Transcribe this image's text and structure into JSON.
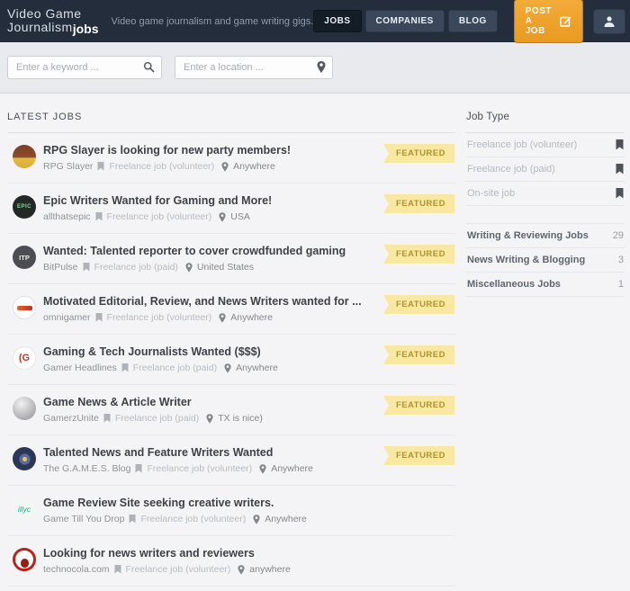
{
  "header": {
    "logo_line1": "Video Game",
    "logo_line2": "Journalism",
    "logo_suffix": "jobs",
    "tagline": "Video game journalism and game writing gigs.",
    "nav": {
      "jobs": "JOBS",
      "companies": "COMPANIES",
      "blog": "BLOG"
    },
    "post_job_label": "POST A JOB"
  },
  "search": {
    "keyword_placeholder": "Enter a keyword ...",
    "location_placeholder": "Enter a location ..."
  },
  "main": {
    "heading": "LATEST JOBS",
    "featured_label": "FEATURED",
    "jobs": [
      {
        "title": "RPG Slayer is looking for new party members!",
        "company": "RPG Slayer",
        "job_type": "Freelance job (volunteer)",
        "location": "Anywhere",
        "featured": true,
        "avatar_text": ""
      },
      {
        "title": "Epic Writers Wanted for Gaming and More!",
        "company": "allthatsepic",
        "job_type": "Freelance job (volunteer)",
        "location": "USA",
        "featured": true,
        "avatar_text": "EPIC"
      },
      {
        "title": "Wanted: Talented reporter to cover crowdfunded gaming",
        "company": "BitPulse",
        "job_type": "Freelance job (paid)",
        "location": "United States",
        "featured": true,
        "avatar_text": "ITP"
      },
      {
        "title": "Motivated Editorial, Review, and News Writers wanted for ...",
        "company": "omnigamer",
        "job_type": "Freelance job (volunteer)",
        "location": "Anywhere",
        "featured": true,
        "avatar_text": ""
      },
      {
        "title": "Gaming & Tech Journalists Wanted ($$$)",
        "company": "Gamer Headlines",
        "job_type": "Freelance job (paid)",
        "location": "Anywhere",
        "featured": true,
        "avatar_text": "(G"
      },
      {
        "title": "Game News & Article Writer",
        "company": "GamerzUnite",
        "job_type": "Freelance job (paid)",
        "location": "TX is nice)",
        "featured": true,
        "avatar_text": ""
      },
      {
        "title": "Talented News and Feature Writers Wanted",
        "company": "The G.A.M.E.S. Blog",
        "job_type": "Freelance job (volunteer)",
        "location": "Anywhere",
        "featured": true,
        "avatar_text": ""
      },
      {
        "title": "Game Review Site seeking creative writers.",
        "company": "Game Till You Drop",
        "job_type": "Freelance job (volunteer)",
        "location": "Anywhere",
        "featured": false,
        "avatar_text": "illyc"
      },
      {
        "title": "Looking for news writers and reviewers",
        "company": "technocola.com",
        "job_type": "Freelance job (volunteer)",
        "location": "anywhere",
        "featured": false,
        "avatar_text": ""
      }
    ]
  },
  "sidebar": {
    "job_type_heading": "Job Type",
    "filters": [
      {
        "label": "Freelance job (volunteer)"
      },
      {
        "label": "Freelance job (paid)"
      },
      {
        "label": "On-site job"
      }
    ],
    "categories": [
      {
        "label": "Writing & Reviewing Jobs",
        "count": "29"
      },
      {
        "label": "News Writing & Blogging",
        "count": "3"
      },
      {
        "label": "Miscellaneous Jobs",
        "count": "1"
      }
    ]
  },
  "colors": {
    "header_bg": "#232d3b",
    "accent_orange": "#efa42e",
    "featured_bg": "#f8e8a2",
    "featured_text": "#b2922e",
    "page_bg": "#f4f4f6"
  }
}
